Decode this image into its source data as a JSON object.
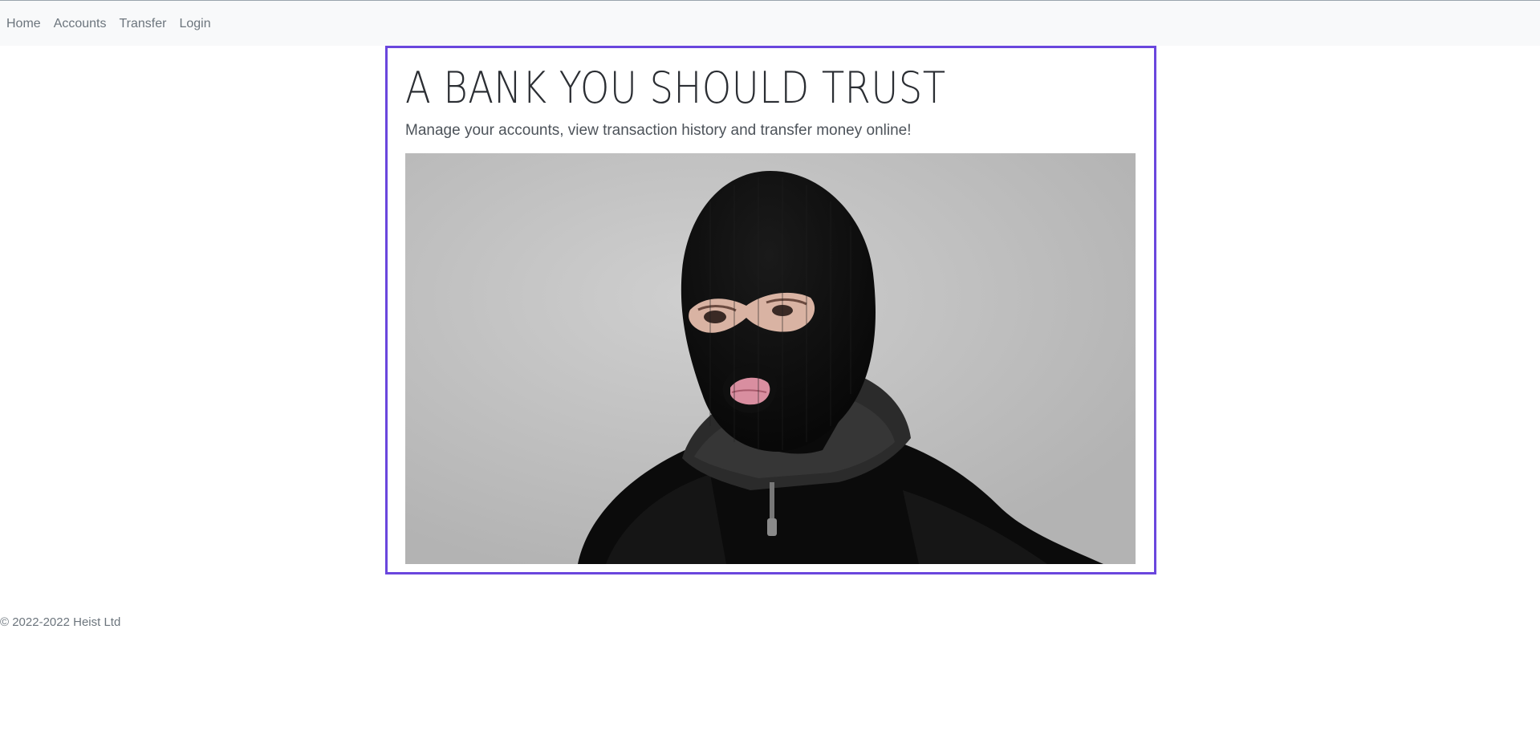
{
  "nav": {
    "items": [
      {
        "label": "Home"
      },
      {
        "label": "Accounts"
      },
      {
        "label": "Transfer"
      },
      {
        "label": "Login"
      }
    ]
  },
  "hero": {
    "title": "A BANK YOU SHOULD TRUST",
    "subtitle": "Manage your accounts, view transaction history and transfer money online!",
    "accent_color": "#6a46dd"
  },
  "footer": {
    "copyright": "© 2022-2022 Heist Ltd"
  }
}
